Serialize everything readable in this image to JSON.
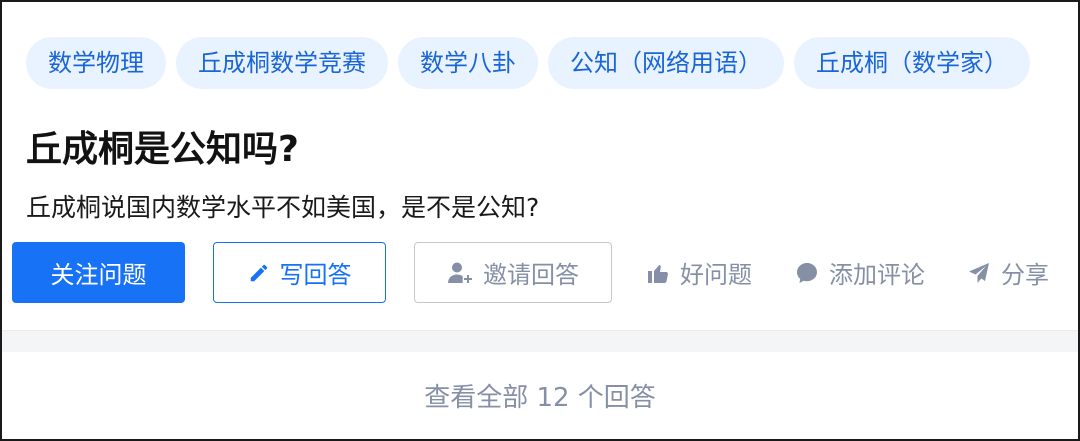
{
  "topics": [
    {
      "label": "数学物理"
    },
    {
      "label": "丘成桐数学竞赛"
    },
    {
      "label": "数学八卦"
    },
    {
      "label": "公知（网络用语）"
    },
    {
      "label": "丘成桐（数学家）"
    }
  ],
  "question": {
    "title": "丘成桐是公知吗?",
    "detail": "丘成桐说国内数学水平不如美国，是不是公知?"
  },
  "actions": {
    "follow_label": "关注问题",
    "write_label": "写回答",
    "invite_label": "邀请回答",
    "good_label": "好问题",
    "comment_label": "添加评论",
    "share_label": "分享"
  },
  "footer": {
    "view_all_label": "查看全部 12 个回答"
  },
  "colors": {
    "primary": "#1772f6",
    "tag_bg": "#e9f2ff",
    "tag_text": "#1a66d6",
    "muted": "#8590a6"
  }
}
